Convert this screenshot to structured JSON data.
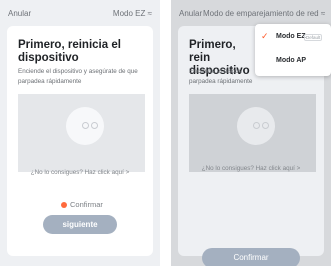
{
  "left_screen": {
    "header": {
      "cancel": "Anular",
      "mode": "Modo EZ ≈"
    },
    "title": "Primero, reinicia el dispositivo",
    "description": "Enciende el dispositivo y asegúrate de que parpadea rápidamente",
    "help_link": "¿No lo consigues? Haz click aquí >",
    "confirm_label": "Confirmar",
    "next_button": "siguiente"
  },
  "right_screen": {
    "header": {
      "cancel": "Anular",
      "mode": "Modo de emparejamiento de red ≈"
    },
    "title": "Primero, rein dispositivo",
    "description": "Enciende el dispos parpadea rápidamente",
    "help_link": "¿No lo consigues? Haz click aquí >",
    "confirm_button": "Confirmar",
    "dropdown": {
      "options": [
        {
          "label": "Modo EZ",
          "badge": "Default",
          "selected": true
        },
        {
          "label": "Modo AP",
          "badge": "",
          "selected": false
        }
      ]
    }
  },
  "colors": {
    "accent": "#ff6a3d",
    "button": "#a4b0c0"
  }
}
